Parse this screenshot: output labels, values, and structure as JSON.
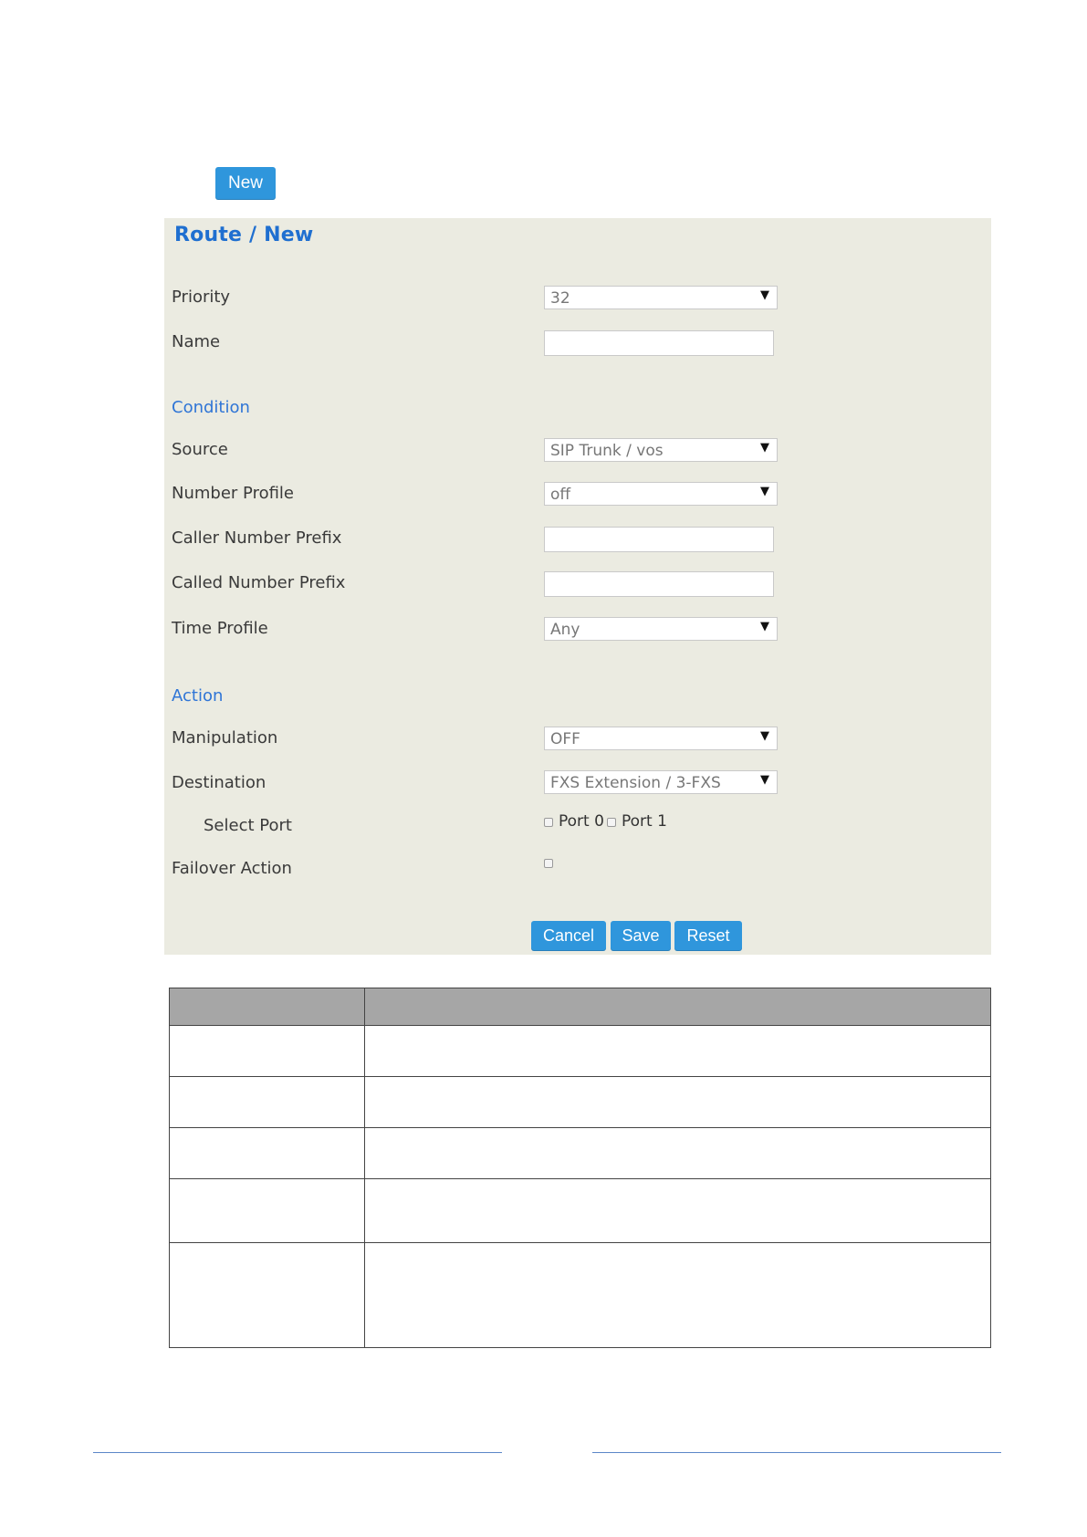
{
  "toolbar": {
    "new_label": "New"
  },
  "panel": {
    "title": "Route / New",
    "fields": {
      "priority": {
        "label": "Priority",
        "value": "32"
      },
      "name": {
        "label": "Name",
        "value": ""
      },
      "source": {
        "label": "Source",
        "value": "SIP Trunk / vos"
      },
      "number_profile": {
        "label": "Number Profile",
        "value": "off"
      },
      "caller_prefix": {
        "label": "Caller Number Prefix",
        "value": ""
      },
      "called_prefix": {
        "label": "Called Number Prefix",
        "value": ""
      },
      "time_profile": {
        "label": "Time Profile",
        "value": "Any"
      },
      "manipulation": {
        "label": "Manipulation",
        "value": "OFF"
      },
      "destination": {
        "label": "Destination",
        "value": "FXS Extension / 3-FXS"
      },
      "select_port": {
        "label": "Select Port",
        "options": [
          "Port 0",
          "Port 1"
        ]
      },
      "failover": {
        "label": "Failover Action"
      }
    },
    "sections": {
      "condition": "Condition",
      "action": "Action"
    },
    "buttons": {
      "cancel": "Cancel",
      "save": "Save",
      "reset": "Reset"
    }
  },
  "icons": {
    "dropdown": "triangle-down-icon",
    "arrow_glyph": "▼"
  }
}
